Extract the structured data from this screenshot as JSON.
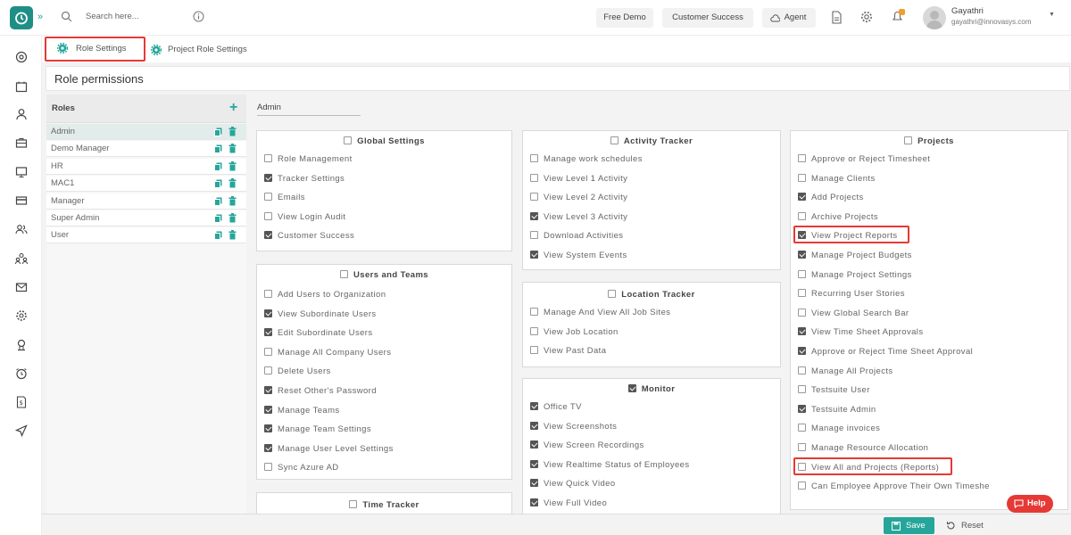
{
  "topbar": {
    "search_placeholder": "Search here...",
    "free_demo": "Free Demo",
    "customer_success": "Customer Success",
    "agent": "Agent",
    "user_name": "Gayathri",
    "user_email": "gayathri@innovasys.com"
  },
  "sidebar": {
    "icons": [
      "dashboard-icon",
      "calendar-icon",
      "user-icon",
      "briefcase-icon",
      "monitor-icon",
      "card-icon",
      "users-icon",
      "team-icon",
      "mail-icon",
      "settings-icon",
      "badge-icon",
      "alarm-icon",
      "invoice-icon",
      "send-icon"
    ]
  },
  "tabs": {
    "role_settings": "Role Settings",
    "project_role_settings": "Project Role Settings"
  },
  "page_title": "Role permissions",
  "roles": {
    "header": "Roles",
    "items": [
      "Admin",
      "Demo Manager",
      "HR",
      "MAC1",
      "Manager",
      "Super Admin",
      "User"
    ],
    "selected": "Admin"
  },
  "selected_role": "Admin",
  "sections": {
    "global": {
      "title": "Global Settings",
      "items": [
        {
          "label": "Role Management",
          "checked": false
        },
        {
          "label": "Tracker Settings",
          "checked": true
        },
        {
          "label": "Emails",
          "checked": false
        },
        {
          "label": "View Login Audit",
          "checked": false
        },
        {
          "label": "Customer Success",
          "checked": true
        }
      ]
    },
    "users": {
      "title": "Users and Teams",
      "items": [
        {
          "label": "Add Users to Organization",
          "checked": false
        },
        {
          "label": "View Subordinate Users",
          "checked": true
        },
        {
          "label": "Edit Subordinate Users",
          "checked": true
        },
        {
          "label": "Manage All Company Users",
          "checked": false
        },
        {
          "label": "Delete Users",
          "checked": false
        },
        {
          "label": "Reset Other's Password",
          "checked": true
        },
        {
          "label": "Manage Teams",
          "checked": true
        },
        {
          "label": "Manage Team Settings",
          "checked": true
        },
        {
          "label": "Manage User Level Settings",
          "checked": true
        },
        {
          "label": "Sync Azure AD",
          "checked": false
        }
      ]
    },
    "time": {
      "title": "Time Tracker"
    },
    "activity": {
      "title": "Activity Tracker",
      "items": [
        {
          "label": "Manage work schedules",
          "checked": false
        },
        {
          "label": "View Level 1 Activity",
          "checked": false
        },
        {
          "label": "View Level 2 Activity",
          "checked": false
        },
        {
          "label": "View Level 3 Activity",
          "checked": true
        },
        {
          "label": "Download Activities",
          "checked": false
        },
        {
          "label": "View System Events",
          "checked": true
        }
      ]
    },
    "location": {
      "title": "Location Tracker",
      "items": [
        {
          "label": "Manage And View All Job Sites",
          "checked": false
        },
        {
          "label": "View Job Location",
          "checked": false
        },
        {
          "label": "View Past Data",
          "checked": false
        }
      ]
    },
    "monitor": {
      "title": "Monitor",
      "items": [
        {
          "label": "Office TV",
          "checked": true
        },
        {
          "label": "View Screenshots",
          "checked": true
        },
        {
          "label": "View Screen Recordings",
          "checked": true
        },
        {
          "label": "View Realtime Status of Employees",
          "checked": true
        },
        {
          "label": "View Quick Video",
          "checked": true
        },
        {
          "label": "View Full Video",
          "checked": true
        }
      ]
    },
    "projects": {
      "title": "Projects",
      "items": [
        {
          "label": "Approve or Reject Timesheet",
          "checked": false
        },
        {
          "label": "Manage Clients",
          "checked": false
        },
        {
          "label": "Add Projects",
          "checked": true
        },
        {
          "label": "Archive Projects",
          "checked": false
        },
        {
          "label": "View Project Reports",
          "checked": true
        },
        {
          "label": "Manage Project Budgets",
          "checked": true
        },
        {
          "label": "Manage Project Settings",
          "checked": false
        },
        {
          "label": "Recurring User Stories",
          "checked": false
        },
        {
          "label": "View Global Search Bar",
          "checked": false
        },
        {
          "label": "View Time Sheet Approvals",
          "checked": true
        },
        {
          "label": "Approve or Reject Time Sheet Approval",
          "checked": true
        },
        {
          "label": "Manage All Projects",
          "checked": false
        },
        {
          "label": "Testsuite User",
          "checked": false
        },
        {
          "label": "Testsuite Admin",
          "checked": true
        },
        {
          "label": "Manage invoices",
          "checked": false
        },
        {
          "label": "Manage Resource Allocation",
          "checked": false
        },
        {
          "label": "View All and Projects (Reports)",
          "checked": false
        },
        {
          "label": "Can Employee Approve Their Own Timeshe",
          "checked": false
        }
      ]
    }
  },
  "buttons": {
    "save": "Save",
    "reset": "Reset",
    "help": "Help"
  },
  "colors": {
    "accent": "#26a69a",
    "highlight": "#e53935"
  }
}
